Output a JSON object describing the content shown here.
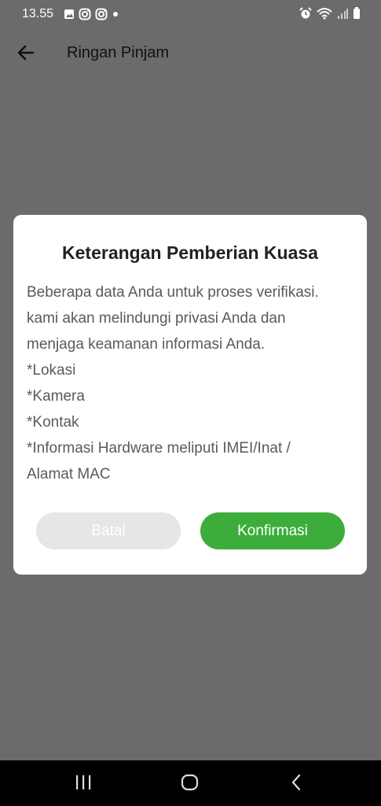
{
  "status_bar": {
    "time": "13.55",
    "notification_icons": [
      "image-icon",
      "instagram-icon",
      "instagram-icon",
      "dot-icon"
    ],
    "system_icons": [
      "alarm-icon",
      "wifi-icon",
      "signal-icon",
      "battery-icon"
    ]
  },
  "app_bar": {
    "title": "Ringan Pinjam"
  },
  "dialog": {
    "title": "Keterangan Pemberian Kuasa",
    "body_lines": [
      "Beberapa data Anda untuk proses verifikasi.",
      "kami akan melindungi privasi Anda dan",
      "menjaga keamanan informasi Anda.",
      "*Lokasi",
      "*Kamera",
      "*Kontak",
      "*Informasi Hardware meliputi IMEI/Inat /",
      "Alamat MAC"
    ],
    "cancel_label": "Batal",
    "confirm_label": "Konfirmasi"
  },
  "colors": {
    "overlay": "#6b6b6b",
    "accent": "#3cad3a",
    "disabled": "#e6e6e6"
  }
}
